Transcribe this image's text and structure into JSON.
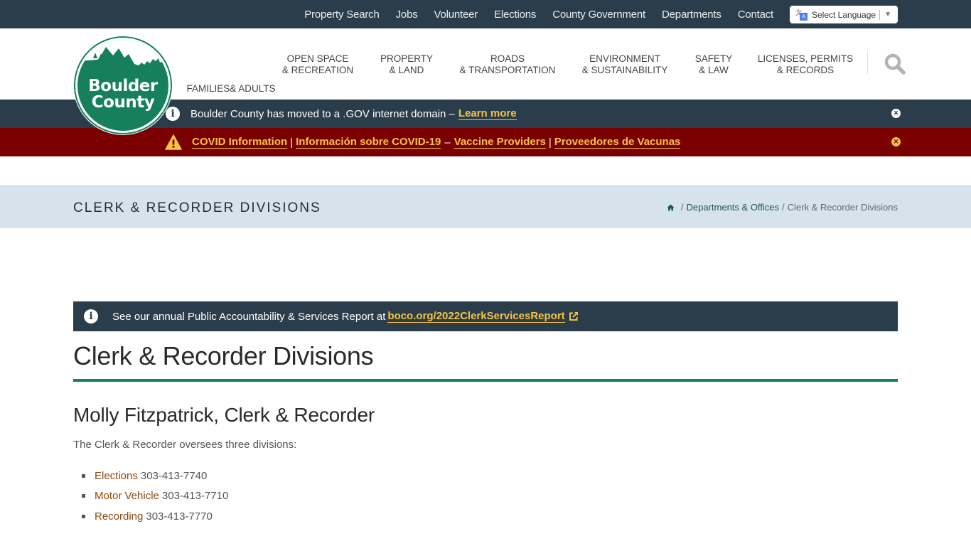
{
  "utility_nav": {
    "items": [
      "Property Search",
      "Jobs",
      "Volunteer",
      "Elections",
      "County Government",
      "Departments",
      "Contact"
    ],
    "language_select": "Select Language"
  },
  "logo": {
    "line1": "Boulder",
    "line2": "County"
  },
  "main_nav": {
    "items": [
      {
        "line1": "FAMILIES",
        "line2": "& ADULTS"
      },
      {
        "line1": "OPEN SPACE",
        "line2": "& RECREATION"
      },
      {
        "line1": "PROPERTY",
        "line2": "& LAND"
      },
      {
        "line1": "ROADS",
        "line2": "& TRANSPORTATION"
      },
      {
        "line1": "ENVIRONMENT",
        "line2": "& SUSTAINABILITY"
      },
      {
        "line1": "SAFETY",
        "line2": "& LAW"
      },
      {
        "line1": "LICENSES, PERMITS",
        "line2": "& RECORDS"
      }
    ],
    "search_icon": "search-icon"
  },
  "alerts": {
    "gov": {
      "icon": "info-icon",
      "text": "Boulder County has moved to a .GOV internet domain –",
      "link": "Learn more"
    },
    "covid": {
      "icon": "warning-icon",
      "links": [
        "COVID Information",
        "Información sobre COVID-19",
        "Vaccine Providers",
        "Proveedores de Vacunas"
      ],
      "separator": "|",
      "dash": "–"
    }
  },
  "title_band": {
    "title": "CLERK & RECORDER DIVISIONS",
    "breadcrumb": {
      "home_icon": "home-icon",
      "separator": "/",
      "link": "Departments & Offices",
      "current": "Clerk & Recorder Divisions"
    }
  },
  "report_banner": {
    "icon": "info-icon",
    "text": "See our annual Public Accountability & Services Report at",
    "link": "boco.org/2022ClerkServicesReport"
  },
  "content": {
    "heading": "Clerk & Recorder Divisions",
    "subheading": "Molly Fitzpatrick, Clerk & Recorder",
    "intro": "The Clerk & Recorder oversees three divisions:",
    "divisions": [
      {
        "name": "Elections",
        "phone": "303-413-7740"
      },
      {
        "name": "Motor Vehicle",
        "phone": "303-413-7710"
      },
      {
        "name": "Recording",
        "phone": "303-413-7770"
      }
    ]
  },
  "colors": {
    "navy": "#2b3d4b",
    "covid_red": "#7a0000",
    "link_gold": "#f7c342",
    "brand_green": "#16805d",
    "title_band": "#d7e3ec",
    "division_link": "#8b4a13"
  }
}
